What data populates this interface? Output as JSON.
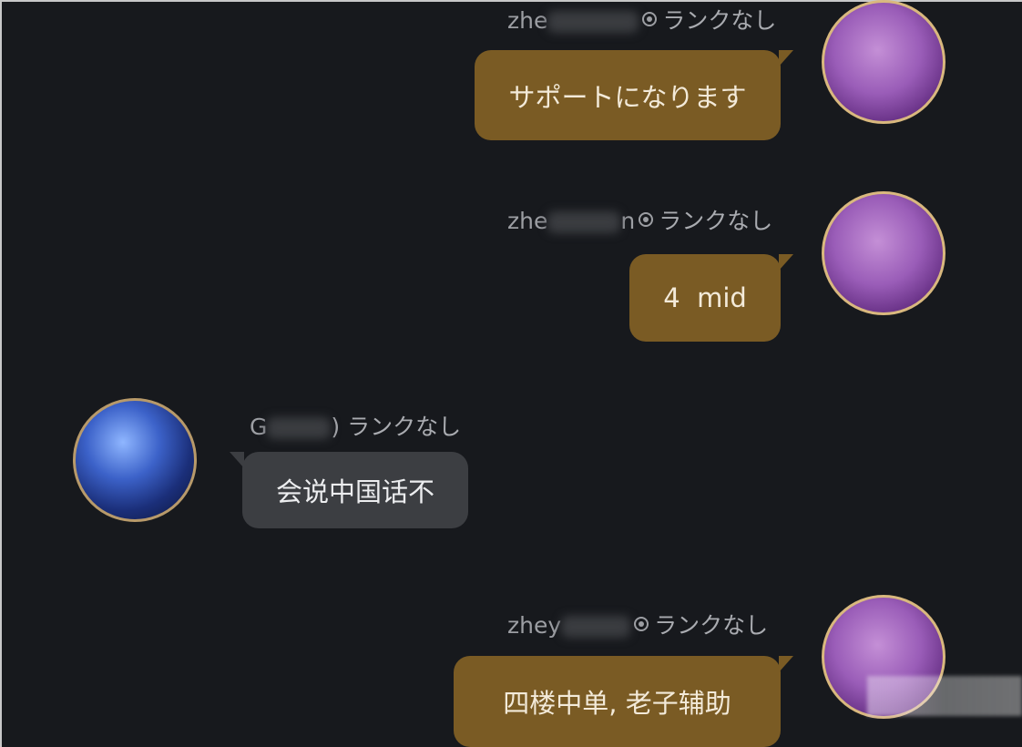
{
  "chat": {
    "messages": [
      {
        "side": "out",
        "name": "zhe",
        "rank": "ランクなし",
        "text": "サポートになります",
        "avatar": "purple-hero-avatar"
      },
      {
        "side": "out",
        "name": "zhe",
        "name_tail": "n",
        "rank": "ランクなし",
        "text": "4  mid",
        "avatar": "purple-hero-avatar"
      },
      {
        "side": "in",
        "name": "G",
        "rank": ") ランクなし",
        "text": "会说中国话不",
        "avatar": "blue-hero-avatar"
      },
      {
        "side": "out",
        "name": "zhey",
        "rank": "ランクなし",
        "text": "四楼中单, 老子辅助",
        "avatar": "purple-hero-avatar"
      }
    ]
  },
  "colors": {
    "background": "#17191d",
    "outgoing_bubble": "#7a5b24",
    "incoming_bubble": "#3c3e42",
    "meta_text": "#9c9ea3"
  }
}
